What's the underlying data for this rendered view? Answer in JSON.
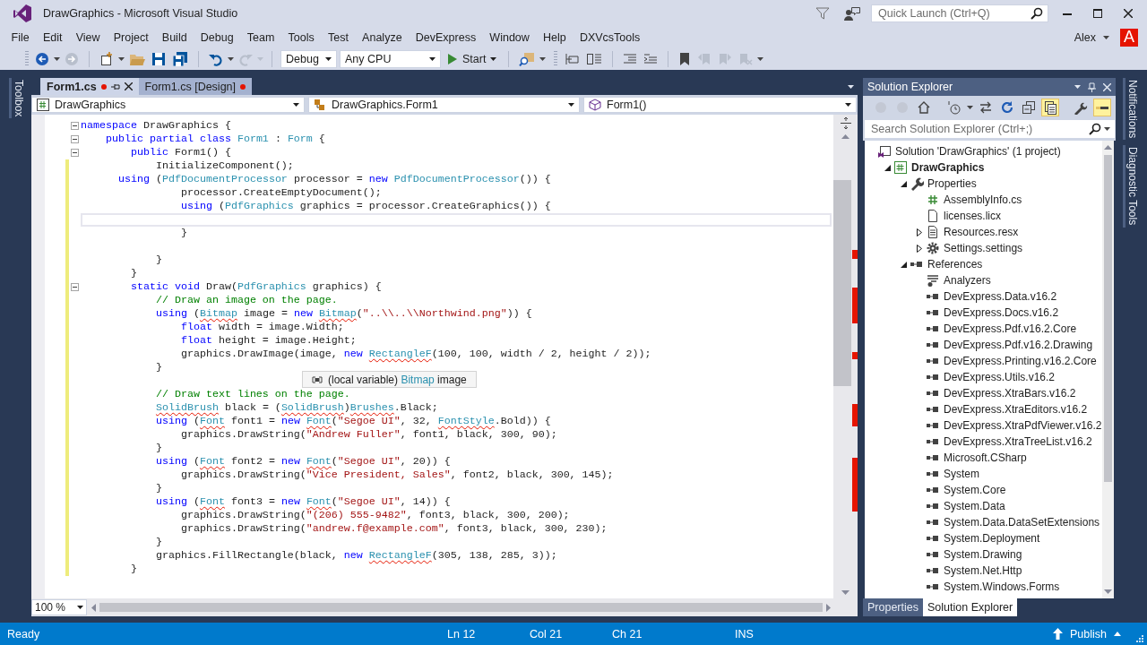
{
  "window": {
    "title": "DrawGraphics - Microsoft Visual Studio"
  },
  "quick_launch": {
    "placeholder": "Quick Launch (Ctrl+Q)"
  },
  "menu": [
    "File",
    "Edit",
    "View",
    "Project",
    "Build",
    "Debug",
    "Team",
    "Tools",
    "Test",
    "Analyze",
    "DevExpress",
    "Window",
    "Help",
    "DXVcsTools"
  ],
  "account": {
    "name": "Alex",
    "initial": "A"
  },
  "toolbar": {
    "configuration": "Debug",
    "platform": "Any CPU",
    "start": "Start"
  },
  "side_tabs_left": [
    "Toolbox"
  ],
  "side_tabs_right": [
    "Notifications",
    "Diagnostic Tools"
  ],
  "editor": {
    "tabs": [
      {
        "label": "Form1.cs",
        "selected": true,
        "modified": true
      },
      {
        "label": "Form1.cs [Design]",
        "selected": false,
        "modified": true
      }
    ],
    "navigation": [
      "DrawGraphics",
      "DrawGraphics.Form1",
      "Form1()"
    ],
    "lines": [
      {
        "segments": [
          {
            "kind": "keyword",
            "text": "namespace"
          },
          {
            "kind": "plain",
            "text": " DrawGraphics {"
          }
        ],
        "changed": false,
        "fold": true,
        "current": false
      },
      {
        "segments": [
          {
            "kind": "keyword",
            "text": "    public partial class "
          },
          {
            "kind": "type",
            "text": "Form1"
          },
          {
            "kind": "plain",
            "text": " : "
          },
          {
            "kind": "type",
            "text": "Form"
          },
          {
            "kind": "plain",
            "text": " {"
          }
        ],
        "changed": false,
        "fold": true,
        "current": false
      },
      {
        "segments": [
          {
            "kind": "keyword",
            "text": "        public"
          },
          {
            "kind": "plain",
            "text": " Form1() {"
          }
        ],
        "changed": false,
        "fold": true,
        "current": false
      },
      {
        "segments": [
          {
            "kind": "plain",
            "text": "            InitializeComponent();"
          }
        ],
        "changed": true,
        "fold": false,
        "current": false
      },
      {
        "segments": [
          {
            "kind": "keyword",
            "text": "      using"
          },
          {
            "kind": "plain",
            "text": " ("
          },
          {
            "kind": "type",
            "text": "PdfDocumentProcessor"
          },
          {
            "kind": "plain",
            "text": " processor = "
          },
          {
            "kind": "keyword",
            "text": "new "
          },
          {
            "kind": "type",
            "text": "PdfDocumentProcessor"
          },
          {
            "kind": "plain",
            "text": "()) {"
          }
        ],
        "changed": true,
        "fold": false,
        "current": false
      },
      {
        "segments": [
          {
            "kind": "plain",
            "text": "                processor.CreateEmptyDocument();"
          }
        ],
        "changed": true,
        "fold": false,
        "current": false
      },
      {
        "segments": [
          {
            "kind": "keyword",
            "text": "                using"
          },
          {
            "kind": "plain",
            "text": " ("
          },
          {
            "kind": "type",
            "text": "PdfGraphics"
          },
          {
            "kind": "plain",
            "text": " graphics = processor.CreateGraphics()) {"
          }
        ],
        "changed": true,
        "fold": false,
        "current": false
      },
      {
        "changed": true,
        "fold": false,
        "current": true
      },
      {
        "segments": [
          {
            "kind": "plain",
            "text": "                }"
          }
        ],
        "changed": true,
        "fold": false,
        "current": false
      },
      {
        "changed": true,
        "fold": false,
        "current": false
      },
      {
        "segments": [
          {
            "kind": "plain",
            "text": "            }"
          }
        ],
        "changed": true,
        "fold": false,
        "current": false
      },
      {
        "segments": [
          {
            "kind": "plain",
            "text": "        }"
          }
        ],
        "changed": true,
        "fold": false,
        "current": false
      },
      {
        "segments": [
          {
            "kind": "keyword",
            "text": "        static void"
          },
          {
            "kind": "plain",
            "text": " Draw("
          },
          {
            "kind": "type",
            "text": "PdfGraphics"
          },
          {
            "kind": "plain",
            "text": " graphics) {"
          }
        ],
        "changed": true,
        "fold": true,
        "current": false
      },
      {
        "segments": [
          {
            "kind": "comment",
            "text": "            // Draw an image on the page."
          }
        ],
        "changed": true,
        "fold": false,
        "current": false
      },
      {
        "segments": [
          {
            "kind": "keyword",
            "text": "            using"
          },
          {
            "kind": "plain",
            "text": " ("
          },
          {
            "kind": "unresolved",
            "text": "Bitmap"
          },
          {
            "kind": "plain",
            "text": " image = "
          },
          {
            "kind": "keyword",
            "text": "new "
          },
          {
            "kind": "unresolved",
            "text": "Bitmap"
          },
          {
            "kind": "plain",
            "text": "("
          },
          {
            "kind": "string",
            "text": "\"..\\\\..\\\\Northwind.png\""
          },
          {
            "kind": "plain",
            "text": ")) {"
          }
        ],
        "changed": true,
        "fold": false,
        "current": false
      },
      {
        "segments": [
          {
            "kind": "keyword",
            "text": "                float"
          },
          {
            "kind": "plain",
            "text": " width = image.Width;"
          }
        ],
        "changed": true,
        "fold": false,
        "current": false
      },
      {
        "segments": [
          {
            "kind": "keyword",
            "text": "                float"
          },
          {
            "kind": "plain",
            "text": " height = image.Height;"
          }
        ],
        "changed": true,
        "fold": false,
        "current": false
      },
      {
        "segments": [
          {
            "kind": "plain",
            "text": "                graphics.DrawImage(image, "
          },
          {
            "kind": "keyword",
            "text": "new "
          },
          {
            "kind": "unresolved",
            "text": "RectangleF"
          },
          {
            "kind": "plain",
            "text": "(100, 100, width / 2, height / 2));"
          }
        ],
        "changed": true,
        "fold": false,
        "current": false
      },
      {
        "segments": [
          {
            "kind": "plain",
            "text": "            }"
          }
        ],
        "changed": true,
        "fold": false,
        "current": false
      },
      {
        "changed": true,
        "fold": false,
        "current": false
      },
      {
        "segments": [
          {
            "kind": "comment",
            "text": "            // Draw text lines on the page."
          }
        ],
        "changed": true,
        "fold": false,
        "current": false
      },
      {
        "segments": [
          {
            "kind": "unresolved",
            "text": "            SolidBrush"
          },
          {
            "kind": "plain",
            "text": " black = ("
          },
          {
            "kind": "unresolved",
            "text": "SolidBrush"
          },
          {
            "kind": "plain",
            "text": ")"
          },
          {
            "kind": "unresolved",
            "text": "Brushes"
          },
          {
            "kind": "plain",
            "text": ".Black;"
          }
        ],
        "changed": true,
        "fold": false,
        "current": false
      },
      {
        "segments": [
          {
            "kind": "keyword",
            "text": "            using"
          },
          {
            "kind": "plain",
            "text": " ("
          },
          {
            "kind": "unresolved",
            "text": "Font"
          },
          {
            "kind": "plain",
            "text": " font1 = "
          },
          {
            "kind": "keyword",
            "text": "new "
          },
          {
            "kind": "unresolved",
            "text": "Font"
          },
          {
            "kind": "plain",
            "text": "("
          },
          {
            "kind": "string",
            "text": "\"Segoe UI\""
          },
          {
            "kind": "plain",
            "text": ", 32, "
          },
          {
            "kind": "unresolved",
            "text": "FontStyle"
          },
          {
            "kind": "plain",
            "text": ".Bold)) {"
          }
        ],
        "changed": true,
        "fold": false,
        "current": false
      },
      {
        "segments": [
          {
            "kind": "plain",
            "text": "                graphics.DrawString("
          },
          {
            "kind": "string",
            "text": "\"Andrew Fuller\""
          },
          {
            "kind": "plain",
            "text": ", font1, black, 300, 90);"
          }
        ],
        "changed": true,
        "fold": false,
        "current": false
      },
      {
        "segments": [
          {
            "kind": "plain",
            "text": "            }"
          }
        ],
        "changed": true,
        "fold": false,
        "current": false
      },
      {
        "segments": [
          {
            "kind": "keyword",
            "text": "            using"
          },
          {
            "kind": "plain",
            "text": " ("
          },
          {
            "kind": "unresolved",
            "text": "Font"
          },
          {
            "kind": "plain",
            "text": " font2 = "
          },
          {
            "kind": "keyword",
            "text": "new "
          },
          {
            "kind": "unresolved",
            "text": "Font"
          },
          {
            "kind": "plain",
            "text": "("
          },
          {
            "kind": "string",
            "text": "\"Segoe UI\""
          },
          {
            "kind": "plain",
            "text": ", 20)) {"
          }
        ],
        "changed": true,
        "fold": false,
        "current": false
      },
      {
        "segments": [
          {
            "kind": "plain",
            "text": "                graphics.DrawString("
          },
          {
            "kind": "string",
            "text": "\"Vice President, Sales\""
          },
          {
            "kind": "plain",
            "text": ", font2, black, 300, 145);"
          }
        ],
        "changed": true,
        "fold": false,
        "current": false
      },
      {
        "segments": [
          {
            "kind": "plain",
            "text": "            }"
          }
        ],
        "changed": true,
        "fold": false,
        "current": false
      },
      {
        "segments": [
          {
            "kind": "keyword",
            "text": "            using"
          },
          {
            "kind": "plain",
            "text": " ("
          },
          {
            "kind": "unresolved",
            "text": "Font"
          },
          {
            "kind": "plain",
            "text": " font3 = "
          },
          {
            "kind": "keyword",
            "text": "new "
          },
          {
            "kind": "unresolved",
            "text": "Font"
          },
          {
            "kind": "plain",
            "text": "("
          },
          {
            "kind": "string",
            "text": "\"Segoe UI\""
          },
          {
            "kind": "plain",
            "text": ", 14)) {"
          }
        ],
        "changed": true,
        "fold": false,
        "current": false
      },
      {
        "segments": [
          {
            "kind": "plain",
            "text": "                graphics.DrawString("
          },
          {
            "kind": "string",
            "text": "\"(206) 555-9482\""
          },
          {
            "kind": "plain",
            "text": ", font3, black, 300, 200);"
          }
        ],
        "changed": true,
        "fold": false,
        "current": false
      },
      {
        "segments": [
          {
            "kind": "plain",
            "text": "                graphics.DrawString("
          },
          {
            "kind": "string",
            "text": "\"andrew.f@example.com\""
          },
          {
            "kind": "plain",
            "text": ", font3, black, 300, 230);"
          }
        ],
        "changed": true,
        "fold": false,
        "current": false
      },
      {
        "segments": [
          {
            "kind": "plain",
            "text": "            }"
          }
        ],
        "changed": true,
        "fold": false,
        "current": false
      },
      {
        "segments": [
          {
            "kind": "plain",
            "text": "            graphics.FillRectangle(black, "
          },
          {
            "kind": "keyword",
            "text": "new "
          },
          {
            "kind": "unresolved",
            "text": "RectangleF"
          },
          {
            "kind": "plain",
            "text": "(305, 138, 285, 3));"
          }
        ],
        "changed": true,
        "fold": false,
        "current": false
      },
      {
        "segments": [
          {
            "kind": "plain",
            "text": "        }"
          }
        ],
        "changed": true,
        "fold": false,
        "current": false
      }
    ],
    "tooltip": {
      "segments": [
        {
          "kind": "plain",
          "text": "(local variable) "
        },
        {
          "kind": "type",
          "text": "Bitmap"
        },
        {
          "kind": "plain",
          "text": " image"
        }
      ]
    },
    "zoom": "100 %"
  },
  "solution_explorer": {
    "title": "Solution Explorer",
    "search": {
      "placeholder": "Search Solution Explorer (Ctrl+;)"
    },
    "tree": [
      {
        "label": "Solution 'DrawGraphics' (1 project)",
        "kind": "solution",
        "children": [
          {
            "label": "DrawGraphics",
            "kind": "project",
            "expanded": true,
            "children": [
              {
                "label": "Properties",
                "kind": "properties",
                "expanded": true,
                "children": [
                  {
                    "label": "AssemblyInfo.cs",
                    "kind": "csharp"
                  },
                  {
                    "label": "licenses.licx",
                    "kind": "file"
                  },
                  {
                    "label": "Resources.resx",
                    "kind": "resources",
                    "expanded": false
                  },
                  {
                    "label": "Settings.settings",
                    "kind": "settings",
                    "expanded": false
                  }
                ]
              },
              {
                "label": "References",
                "kind": "references",
                "expanded": true,
                "children": [
                  {
                    "label": "Analyzers",
                    "kind": "analyzers"
                  },
                  {
                    "label": "DevExpress.Data.v16.2",
                    "kind": "reference"
                  },
                  {
                    "label": "DevExpress.Docs.v16.2",
                    "kind": "reference"
                  },
                  {
                    "label": "DevExpress.Pdf.v16.2.Core",
                    "kind": "reference"
                  },
                  {
                    "label": "DevExpress.Pdf.v16.2.Drawing",
                    "kind": "reference"
                  },
                  {
                    "label": "DevExpress.Printing.v16.2.Core",
                    "kind": "reference"
                  },
                  {
                    "label": "DevExpress.Utils.v16.2",
                    "kind": "reference"
                  },
                  {
                    "label": "DevExpress.XtraBars.v16.2",
                    "kind": "reference"
                  },
                  {
                    "label": "DevExpress.XtraEditors.v16.2",
                    "kind": "reference"
                  },
                  {
                    "label": "DevExpress.XtraPdfViewer.v16.2",
                    "kind": "reference"
                  },
                  {
                    "label": "DevExpress.XtraTreeList.v16.2",
                    "kind": "reference"
                  },
                  {
                    "label": "Microsoft.CSharp",
                    "kind": "reference"
                  },
                  {
                    "label": "System",
                    "kind": "reference"
                  },
                  {
                    "label": "System.Core",
                    "kind": "reference"
                  },
                  {
                    "label": "System.Data",
                    "kind": "reference"
                  },
                  {
                    "label": "System.Data.DataSetExtensions",
                    "kind": "reference"
                  },
                  {
                    "label": "System.Deployment",
                    "kind": "reference"
                  },
                  {
                    "label": "System.Drawing",
                    "kind": "reference"
                  },
                  {
                    "label": "System.Net.Http",
                    "kind": "reference"
                  },
                  {
                    "label": "System.Windows.Forms",
                    "kind": "reference"
                  }
                ]
              }
            ]
          }
        ]
      }
    ],
    "tabs": [
      {
        "label": "Properties",
        "selected": false
      },
      {
        "label": "Solution Explorer",
        "selected": true
      }
    ]
  },
  "status_bar": {
    "message": "Ready",
    "line": "Ln 12",
    "column": "Col 21",
    "char": "Ch 21",
    "mode": "INS",
    "publish": "Publish"
  }
}
